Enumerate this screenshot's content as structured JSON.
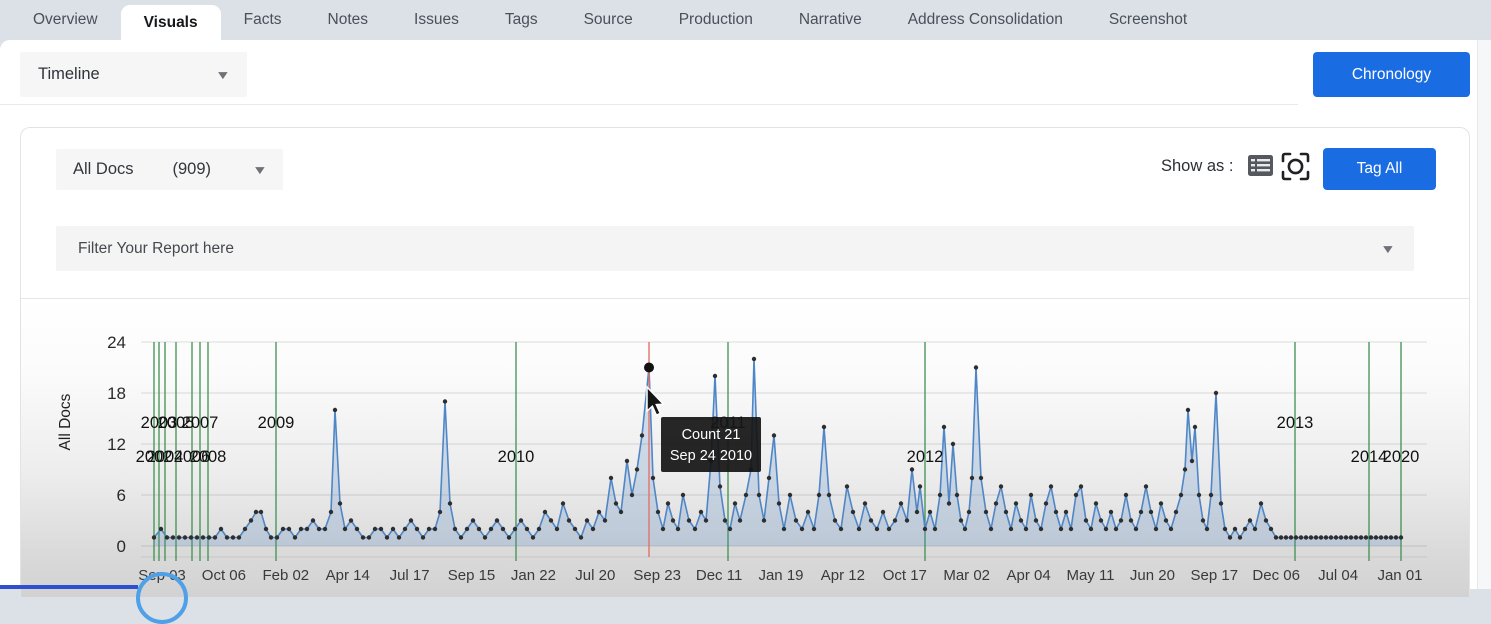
{
  "tab_bar": {
    "tabs": [
      {
        "label": "Overview",
        "active": false
      },
      {
        "label": "Visuals",
        "active": true
      },
      {
        "label": "Facts",
        "active": false
      },
      {
        "label": "Notes",
        "active": false
      },
      {
        "label": "Issues",
        "active": false
      },
      {
        "label": "Tags",
        "active": false
      },
      {
        "label": "Source",
        "active": false
      },
      {
        "label": "Production",
        "active": false
      },
      {
        "label": "Narrative",
        "active": false
      },
      {
        "label": "Address Consolidation",
        "active": false
      },
      {
        "label": "Screenshot",
        "active": false
      }
    ]
  },
  "toolbar": {
    "view_dropdown_value": "Timeline",
    "chronology_button": "Chronology"
  },
  "panel": {
    "docs_dropdown_label": "All Docs",
    "docs_dropdown_count": "(909)",
    "show_as_label": "Show as :",
    "tag_all_button": "Tag All",
    "filter_placeholder": "Filter Your Report here"
  },
  "chart_data": {
    "type": "line",
    "title": "",
    "xlabel": "",
    "ylabel": "All Docs",
    "ylim": [
      0,
      24
    ],
    "y_ticks": [
      0,
      6,
      12,
      18,
      24
    ],
    "grid": true,
    "x_tick_labels": [
      "Sep 03",
      "Oct 06",
      "Feb 02",
      "Apr 14",
      "Jul 17",
      "Sep 15",
      "Jan 22",
      "Jul 20",
      "Sep 23",
      "Dec 11",
      "Jan 19",
      "Apr 12",
      "Oct 17",
      "Mar 02",
      "Apr 04",
      "May 11",
      "Jun 20",
      "Sep 17",
      "Dec 06",
      "Jul 04",
      "Jan 01"
    ],
    "x_domain": [
      0,
      1260
    ],
    "year_markers": [
      {
        "year": "2002",
        "x": 5,
        "row": 2
      },
      {
        "year": "2003",
        "x": 10,
        "row": 1
      },
      {
        "year": "2004",
        "x": 16,
        "row": 2
      },
      {
        "year": "2005",
        "x": 27,
        "row": 1
      },
      {
        "year": "2006",
        "x": 43,
        "row": 2
      },
      {
        "year": "2007",
        "x": 51,
        "row": 1
      },
      {
        "year": "2008",
        "x": 59,
        "row": 2
      },
      {
        "year": "2009",
        "x": 127,
        "row": 1
      },
      {
        "year": "2010",
        "x": 367,
        "row": 2
      },
      {
        "year": "2011",
        "x": 579,
        "row": 1
      },
      {
        "year": "2012",
        "x": 776,
        "row": 2
      },
      {
        "year": "2013",
        "x": 1146,
        "row": 1
      },
      {
        "year": "2014",
        "x": 1220,
        "row": 2
      },
      {
        "year": "2020",
        "x": 1252,
        "row": 2
      }
    ],
    "points": [
      [
        5,
        1
      ],
      [
        12,
        2
      ],
      [
        18,
        1
      ],
      [
        24,
        1
      ],
      [
        30,
        1
      ],
      [
        36,
        1
      ],
      [
        42,
        1
      ],
      [
        48,
        1
      ],
      [
        54,
        1
      ],
      [
        60,
        1
      ],
      [
        66,
        1
      ],
      [
        72,
        2
      ],
      [
        78,
        1
      ],
      [
        84,
        1
      ],
      [
        90,
        1
      ],
      [
        96,
        2
      ],
      [
        102,
        3
      ],
      [
        107,
        4
      ],
      [
        112,
        4
      ],
      [
        117,
        2
      ],
      [
        122,
        1
      ],
      [
        128,
        1
      ],
      [
        134,
        2
      ],
      [
        140,
        2
      ],
      [
        146,
        1
      ],
      [
        152,
        2
      ],
      [
        158,
        2
      ],
      [
        164,
        3
      ],
      [
        170,
        2
      ],
      [
        176,
        2
      ],
      [
        182,
        4
      ],
      [
        186,
        16
      ],
      [
        191,
        5
      ],
      [
        196,
        2
      ],
      [
        202,
        3
      ],
      [
        208,
        2
      ],
      [
        214,
        1
      ],
      [
        220,
        1
      ],
      [
        226,
        2
      ],
      [
        232,
        2
      ],
      [
        238,
        1
      ],
      [
        244,
        2
      ],
      [
        250,
        1
      ],
      [
        256,
        2
      ],
      [
        262,
        3
      ],
      [
        268,
        2
      ],
      [
        274,
        1
      ],
      [
        280,
        2
      ],
      [
        286,
        2
      ],
      [
        291,
        4
      ],
      [
        296,
        17
      ],
      [
        301,
        5
      ],
      [
        306,
        2
      ],
      [
        312,
        1
      ],
      [
        318,
        2
      ],
      [
        324,
        3
      ],
      [
        330,
        2
      ],
      [
        336,
        1
      ],
      [
        342,
        2
      ],
      [
        348,
        3
      ],
      [
        354,
        2
      ],
      [
        360,
        1
      ],
      [
        366,
        2
      ],
      [
        372,
        3
      ],
      [
        378,
        2
      ],
      [
        384,
        1
      ],
      [
        390,
        2
      ],
      [
        396,
        4
      ],
      [
        402,
        3
      ],
      [
        408,
        2
      ],
      [
        414,
        5
      ],
      [
        420,
        3
      ],
      [
        426,
        2
      ],
      [
        432,
        1
      ],
      [
        438,
        3
      ],
      [
        444,
        2
      ],
      [
        450,
        4
      ],
      [
        456,
        3
      ],
      [
        462,
        8
      ],
      [
        467,
        5
      ],
      [
        472,
        4
      ],
      [
        478,
        10
      ],
      [
        483,
        6
      ],
      [
        488,
        9
      ],
      [
        493,
        13
      ],
      [
        500,
        21
      ],
      [
        504,
        8
      ],
      [
        509,
        4
      ],
      [
        514,
        2
      ],
      [
        519,
        5
      ],
      [
        524,
        3
      ],
      [
        529,
        2
      ],
      [
        534,
        6
      ],
      [
        540,
        3
      ],
      [
        546,
        2
      ],
      [
        552,
        4
      ],
      [
        557,
        3
      ],
      [
        562,
        10
      ],
      [
        566,
        20
      ],
      [
        571,
        7
      ],
      [
        576,
        3
      ],
      [
        581,
        2
      ],
      [
        586,
        5
      ],
      [
        591,
        3
      ],
      [
        597,
        6
      ],
      [
        602,
        9
      ],
      [
        605,
        22
      ],
      [
        610,
        6
      ],
      [
        615,
        3
      ],
      [
        620,
        8
      ],
      [
        625,
        13
      ],
      [
        630,
        5
      ],
      [
        635,
        2
      ],
      [
        641,
        6
      ],
      [
        647,
        3
      ],
      [
        653,
        2
      ],
      [
        659,
        4
      ],
      [
        665,
        2
      ],
      [
        670,
        6
      ],
      [
        675,
        14
      ],
      [
        680,
        6
      ],
      [
        686,
        3
      ],
      [
        692,
        2
      ],
      [
        698,
        7
      ],
      [
        704,
        4
      ],
      [
        710,
        2
      ],
      [
        716,
        5
      ],
      [
        722,
        3
      ],
      [
        728,
        2
      ],
      [
        734,
        4
      ],
      [
        740,
        2
      ],
      [
        746,
        3
      ],
      [
        752,
        5
      ],
      [
        758,
        3
      ],
      [
        763,
        9
      ],
      [
        768,
        4
      ],
      [
        771,
        7
      ],
      [
        776,
        2
      ],
      [
        781,
        4
      ],
      [
        786,
        2
      ],
      [
        791,
        6
      ],
      [
        795,
        14
      ],
      [
        800,
        5
      ],
      [
        804,
        12
      ],
      [
        808,
        6
      ],
      [
        812,
        3
      ],
      [
        816,
        2
      ],
      [
        820,
        4
      ],
      [
        823,
        8
      ],
      [
        827,
        21
      ],
      [
        832,
        8
      ],
      [
        837,
        4
      ],
      [
        842,
        2
      ],
      [
        847,
        5
      ],
      [
        852,
        7
      ],
      [
        857,
        4
      ],
      [
        862,
        2
      ],
      [
        867,
        5
      ],
      [
        872,
        3
      ],
      [
        877,
        2
      ],
      [
        882,
        6
      ],
      [
        887,
        3
      ],
      [
        892,
        2
      ],
      [
        897,
        5
      ],
      [
        902,
        7
      ],
      [
        907,
        4
      ],
      [
        912,
        2
      ],
      [
        917,
        4
      ],
      [
        922,
        2
      ],
      [
        927,
        6
      ],
      [
        932,
        7
      ],
      [
        937,
        3
      ],
      [
        942,
        2
      ],
      [
        947,
        5
      ],
      [
        952,
        3
      ],
      [
        957,
        2
      ],
      [
        962,
        4
      ],
      [
        967,
        2
      ],
      [
        972,
        3
      ],
      [
        977,
        6
      ],
      [
        982,
        3
      ],
      [
        987,
        2
      ],
      [
        992,
        4
      ],
      [
        997,
        7
      ],
      [
        1002,
        4
      ],
      [
        1007,
        2
      ],
      [
        1012,
        5
      ],
      [
        1017,
        3
      ],
      [
        1022,
        2
      ],
      [
        1027,
        4
      ],
      [
        1032,
        6
      ],
      [
        1036,
        9
      ],
      [
        1039,
        16
      ],
      [
        1043,
        10
      ],
      [
        1046,
        14
      ],
      [
        1050,
        6
      ],
      [
        1054,
        3
      ],
      [
        1058,
        2
      ],
      [
        1062,
        6
      ],
      [
        1067,
        18
      ],
      [
        1072,
        5
      ],
      [
        1076,
        2
      ],
      [
        1081,
        1
      ],
      [
        1086,
        2
      ],
      [
        1091,
        1
      ],
      [
        1096,
        2
      ],
      [
        1101,
        3
      ],
      [
        1106,
        2
      ],
      [
        1112,
        5
      ],
      [
        1117,
        3
      ],
      [
        1122,
        2
      ],
      [
        1127,
        1
      ],
      [
        1132,
        1
      ],
      [
        1137,
        1
      ],
      [
        1142,
        1
      ],
      [
        1147,
        1
      ],
      [
        1152,
        1
      ],
      [
        1157,
        1
      ],
      [
        1162,
        1
      ],
      [
        1167,
        1
      ],
      [
        1172,
        1
      ],
      [
        1177,
        1
      ],
      [
        1182,
        1
      ],
      [
        1187,
        1
      ],
      [
        1192,
        1
      ],
      [
        1197,
        1
      ],
      [
        1202,
        1
      ],
      [
        1207,
        1
      ],
      [
        1212,
        1
      ],
      [
        1217,
        1
      ],
      [
        1222,
        1
      ],
      [
        1227,
        1
      ],
      [
        1232,
        1
      ],
      [
        1237,
        1
      ],
      [
        1242,
        1
      ],
      [
        1247,
        1
      ],
      [
        1252,
        1
      ]
    ],
    "hover": {
      "x": 500,
      "value": 21,
      "tooltip_lines": [
        "Count 21",
        "Sep 24 2010"
      ]
    },
    "legend": [],
    "colors": {
      "line": "#4f86c6",
      "area_fill": "rgba(79,134,198,0.22)",
      "dot": "#2e2e2e",
      "year_line": "#3f9150",
      "hover_line": "#e0736c",
      "tooltip_bg": "rgba(22,22,22,0.93)",
      "accent_blue": "#1a6ce3"
    }
  }
}
